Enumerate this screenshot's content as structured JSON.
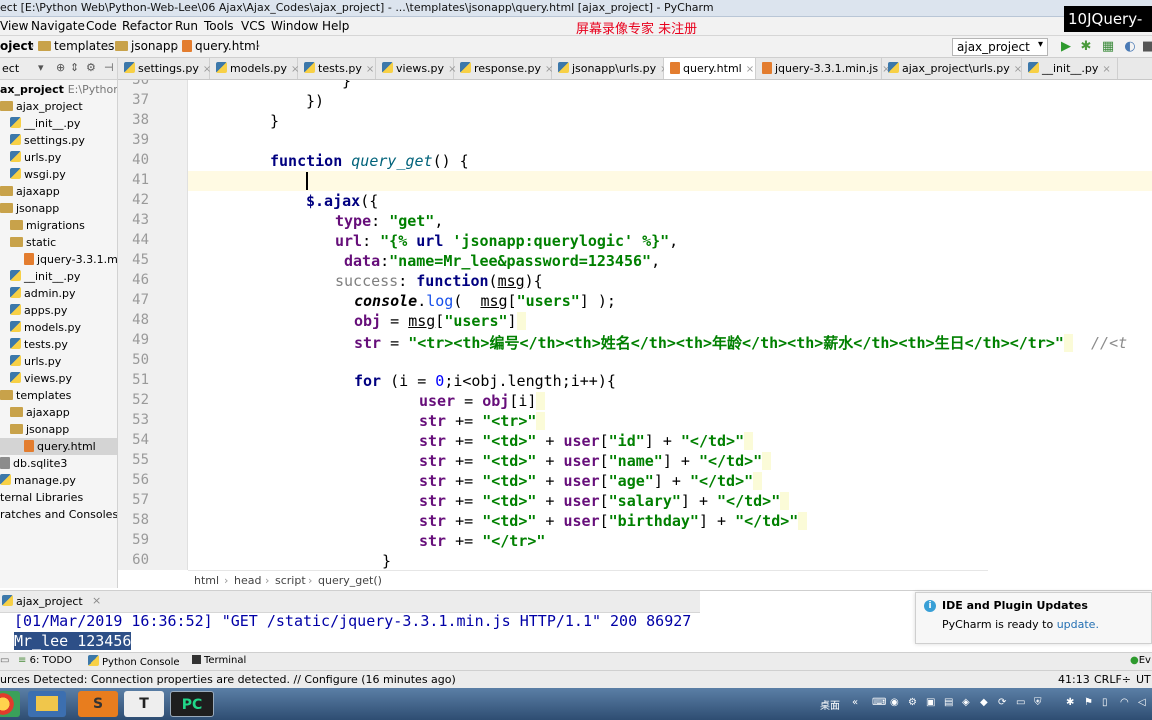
{
  "window": {
    "title": "ect [E:\\Python Web\\Python-Web-Lee\\06 Ajax\\Ajax_Codes\\ajax_project] - ...\\templates\\jsonapp\\query.html [ajax_project] - PyCharm",
    "watermark": "屏幕录像专家  未注册",
    "overlay_badge": "10JQuery-"
  },
  "menu": [
    "View",
    "Navigate",
    "Code",
    "Refactor",
    "Run",
    "Tools",
    "VCS",
    "Window",
    "Help"
  ],
  "navbar": {
    "crumbs": [
      "oject",
      "templates",
      "jsonapp",
      "query.html"
    ],
    "run_config": "ajax_project"
  },
  "project_panel": {
    "header": "ect",
    "rows": [
      {
        "label": "ax_project",
        "extra": "E:\\Python W",
        "type": "folder",
        "bold": true
      },
      {
        "label": "ajax_project",
        "type": "folder"
      },
      {
        "label": "__init__.py",
        "type": "py"
      },
      {
        "label": "settings.py",
        "type": "py"
      },
      {
        "label": "urls.py",
        "type": "py"
      },
      {
        "label": "wsgi.py",
        "type": "py"
      },
      {
        "label": "ajaxapp",
        "type": "folder"
      },
      {
        "label": "jsonapp",
        "type": "folder"
      },
      {
        "label": "migrations",
        "type": "folder"
      },
      {
        "label": "static",
        "type": "folder"
      },
      {
        "label": "jquery-3.3.1.min",
        "type": "file"
      },
      {
        "label": "__init__.py",
        "type": "py"
      },
      {
        "label": "admin.py",
        "type": "py"
      },
      {
        "label": "apps.py",
        "type": "py"
      },
      {
        "label": "models.py",
        "type": "py"
      },
      {
        "label": "tests.py",
        "type": "py"
      },
      {
        "label": "urls.py",
        "type": "py"
      },
      {
        "label": "views.py",
        "type": "py"
      },
      {
        "label": "templates",
        "type": "folder"
      },
      {
        "label": "ajaxapp",
        "type": "folder"
      },
      {
        "label": "jsonapp",
        "type": "folder"
      },
      {
        "label": "query.html",
        "type": "file",
        "selected": true
      },
      {
        "label": "db.sqlite3",
        "type": "file"
      },
      {
        "label": "manage.py",
        "type": "py"
      },
      {
        "label": "ternal Libraries",
        "type": "lib"
      },
      {
        "label": "ratches and Consoles",
        "type": "lib"
      }
    ]
  },
  "tabs": [
    {
      "label": "settings.py"
    },
    {
      "label": "models.py"
    },
    {
      "label": "tests.py"
    },
    {
      "label": "views.py"
    },
    {
      "label": "response.py"
    },
    {
      "label": "jsonapp\\urls.py"
    },
    {
      "label": "query.html",
      "active": true
    },
    {
      "label": "jquery-3.3.1.min.js"
    },
    {
      "label": "ajax_project\\urls.py"
    },
    {
      "label": "__init__.py"
    }
  ],
  "line_numbers": [
    "36",
    "37",
    "38",
    "39",
    "40",
    "41",
    "42",
    "43",
    "44",
    "45",
    "46",
    "47",
    "48",
    "49",
    "50",
    "51",
    "52",
    "53",
    "54",
    "55",
    "56",
    "57",
    "58",
    "59",
    "60"
  ],
  "code": {
    "l36": "}",
    "l37": "})",
    "l38": "}",
    "l40_kw": "function",
    "l40_fn": "query_get",
    "l40_rest": "() {",
    "l42_a": "$.ajax",
    "l42_b": "({",
    "l43_k": "type",
    "l43_v": "\"get\"",
    "l44_k": "url",
    "l44_v1": "\"{% ",
    "l44_v2": "url",
    "l44_v3": " 'jsonapp:querylogic' ",
    "l44_v4": "%}\"",
    "l45_k": "data",
    "l45_v": "\"name=Mr_lee&password=123456\"",
    "l46_k": "success",
    "l46_kw": "function",
    "l46_arg": "msg",
    "l47_obj": "console",
    "l47_m": "log",
    "l47_arg": "msg",
    "l47_s": "\"users\"",
    "l48_v": "obj",
    "l48_arg": "msg",
    "l48_s": "\"users\"",
    "l49_v": "str",
    "l49_s": "\"<tr><th>编号</th><th>姓名</th><th>年龄</th><th>薪水</th><th>生日</th></tr>\"",
    "l49_c": "//<t",
    "l51_kw": "for",
    "l51_a": " (i = ",
    "l51_n": "0",
    "l51_b": ";i<obj.length;i++){",
    "l52_v": "user",
    "l52_r": "obj",
    "l52_i": "[i]",
    "l53_v": "str",
    "l53_s": "\"<tr>\"",
    "l54_s1": "\"<td>\"",
    "l54_u": "user",
    "l54_k": "\"id\"",
    "l54_s2": "\"</td>\"",
    "l55_k": "\"name\"",
    "l56_k": "\"age\"",
    "l57_k": "\"salary\"",
    "l58_k": "\"birthday\"",
    "l59_s": "\"</tr>\"",
    "l60": "}"
  },
  "breadcrumb": [
    "html",
    "head",
    "script",
    "query_get()"
  ],
  "run_panel": {
    "tab": "ajax_project",
    "lines": [
      "[01/Mar/2019 16:36:52] \"GET /static/jquery-3.3.1.min.js HTTP/1.1\" 200 86927",
      "Mr_lee 123456"
    ]
  },
  "notification": {
    "title": "IDE and Plugin Updates",
    "body": "PyCharm is ready to ",
    "link": "update."
  },
  "tool_tabs": [
    "6: TODO",
    "Python Console",
    "Terminal",
    "Ev"
  ],
  "status": {
    "message": "urces Detected: Connection properties are detected. // Configure (16 minutes ago)",
    "position": "41:13",
    "line_sep": "CRLF÷",
    "encoding": "UT"
  },
  "taskbar": {
    "tray_text": "桌面"
  },
  "colors": {
    "keyword": "#000080",
    "string": "#008000",
    "console_text": "#0000a6",
    "selection": "#2d4f87",
    "watermark": "#e8001c"
  }
}
